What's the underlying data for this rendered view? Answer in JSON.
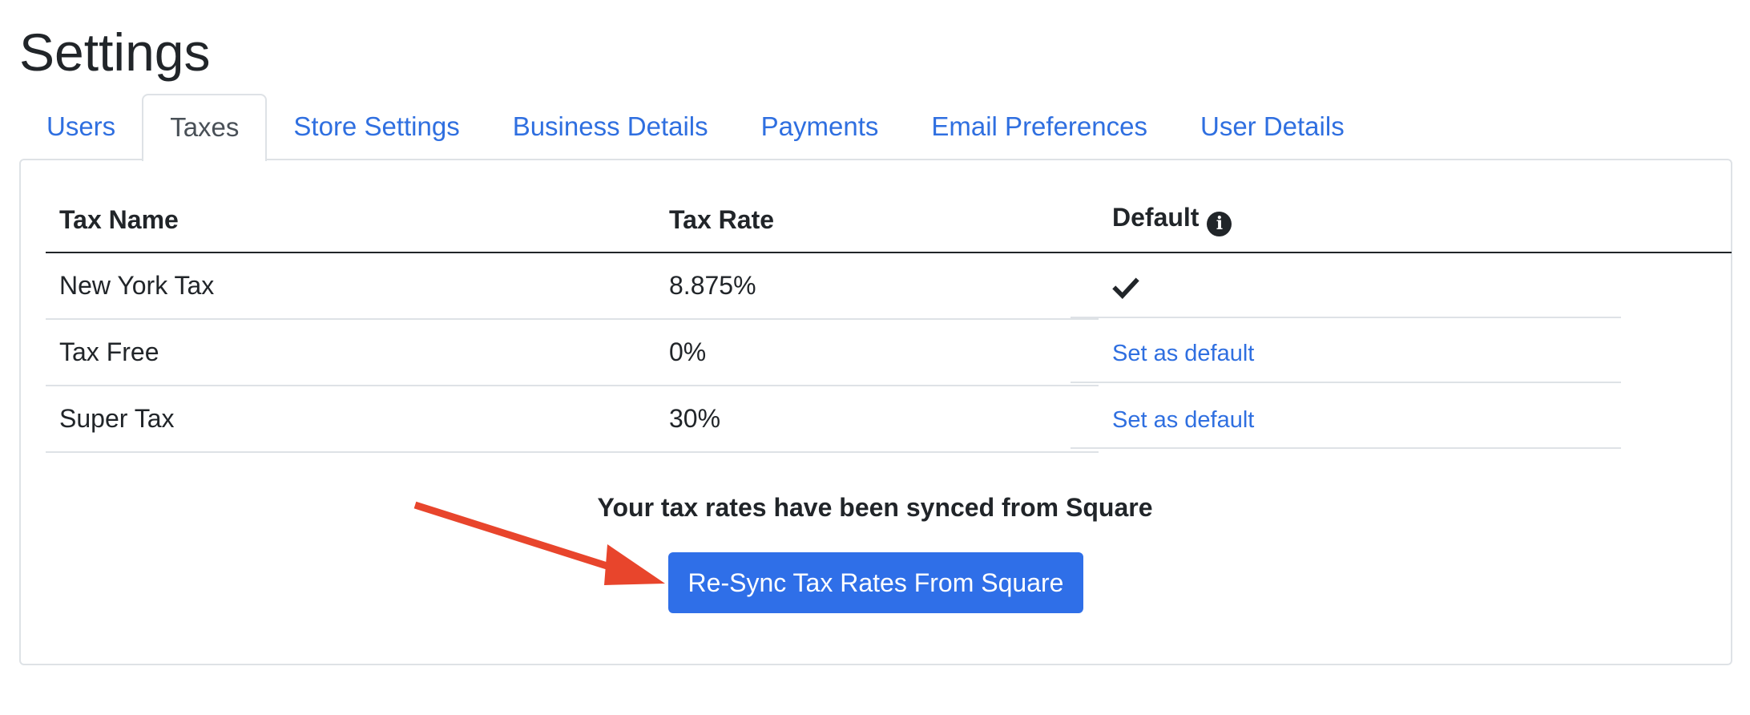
{
  "page": {
    "title": "Settings"
  },
  "tabs": [
    {
      "label": "Users",
      "active": false
    },
    {
      "label": "Taxes",
      "active": true
    },
    {
      "label": "Store Settings",
      "active": false
    },
    {
      "label": "Business Details",
      "active": false
    },
    {
      "label": "Payments",
      "active": false
    },
    {
      "label": "Email Preferences",
      "active": false
    },
    {
      "label": "User Details",
      "active": false
    }
  ],
  "table": {
    "headers": {
      "name": "Tax Name",
      "rate": "Tax Rate",
      "default": "Default",
      "default_info_icon": "info-circle-icon"
    },
    "rows": [
      {
        "name": "New York Tax",
        "rate": "8.875%",
        "is_default": true,
        "default_icon": "checkmark-icon"
      },
      {
        "name": "Tax Free",
        "rate": "0%",
        "is_default": false,
        "action": "Set as default"
      },
      {
        "name": "Super Tax",
        "rate": "30%",
        "is_default": false,
        "action": "Set as default"
      }
    ]
  },
  "sync": {
    "message": "Your tax rates have been synced from Square",
    "button_label": "Re-Sync Tax Rates From Square"
  },
  "annotation": {
    "arrow_icon": "red-arrow-icon",
    "arrow_color": "#e8452c"
  },
  "colors": {
    "link": "#2f6fe0",
    "primary_button": "#2f6fe8",
    "text": "#212529",
    "border": "#dee2e6"
  }
}
